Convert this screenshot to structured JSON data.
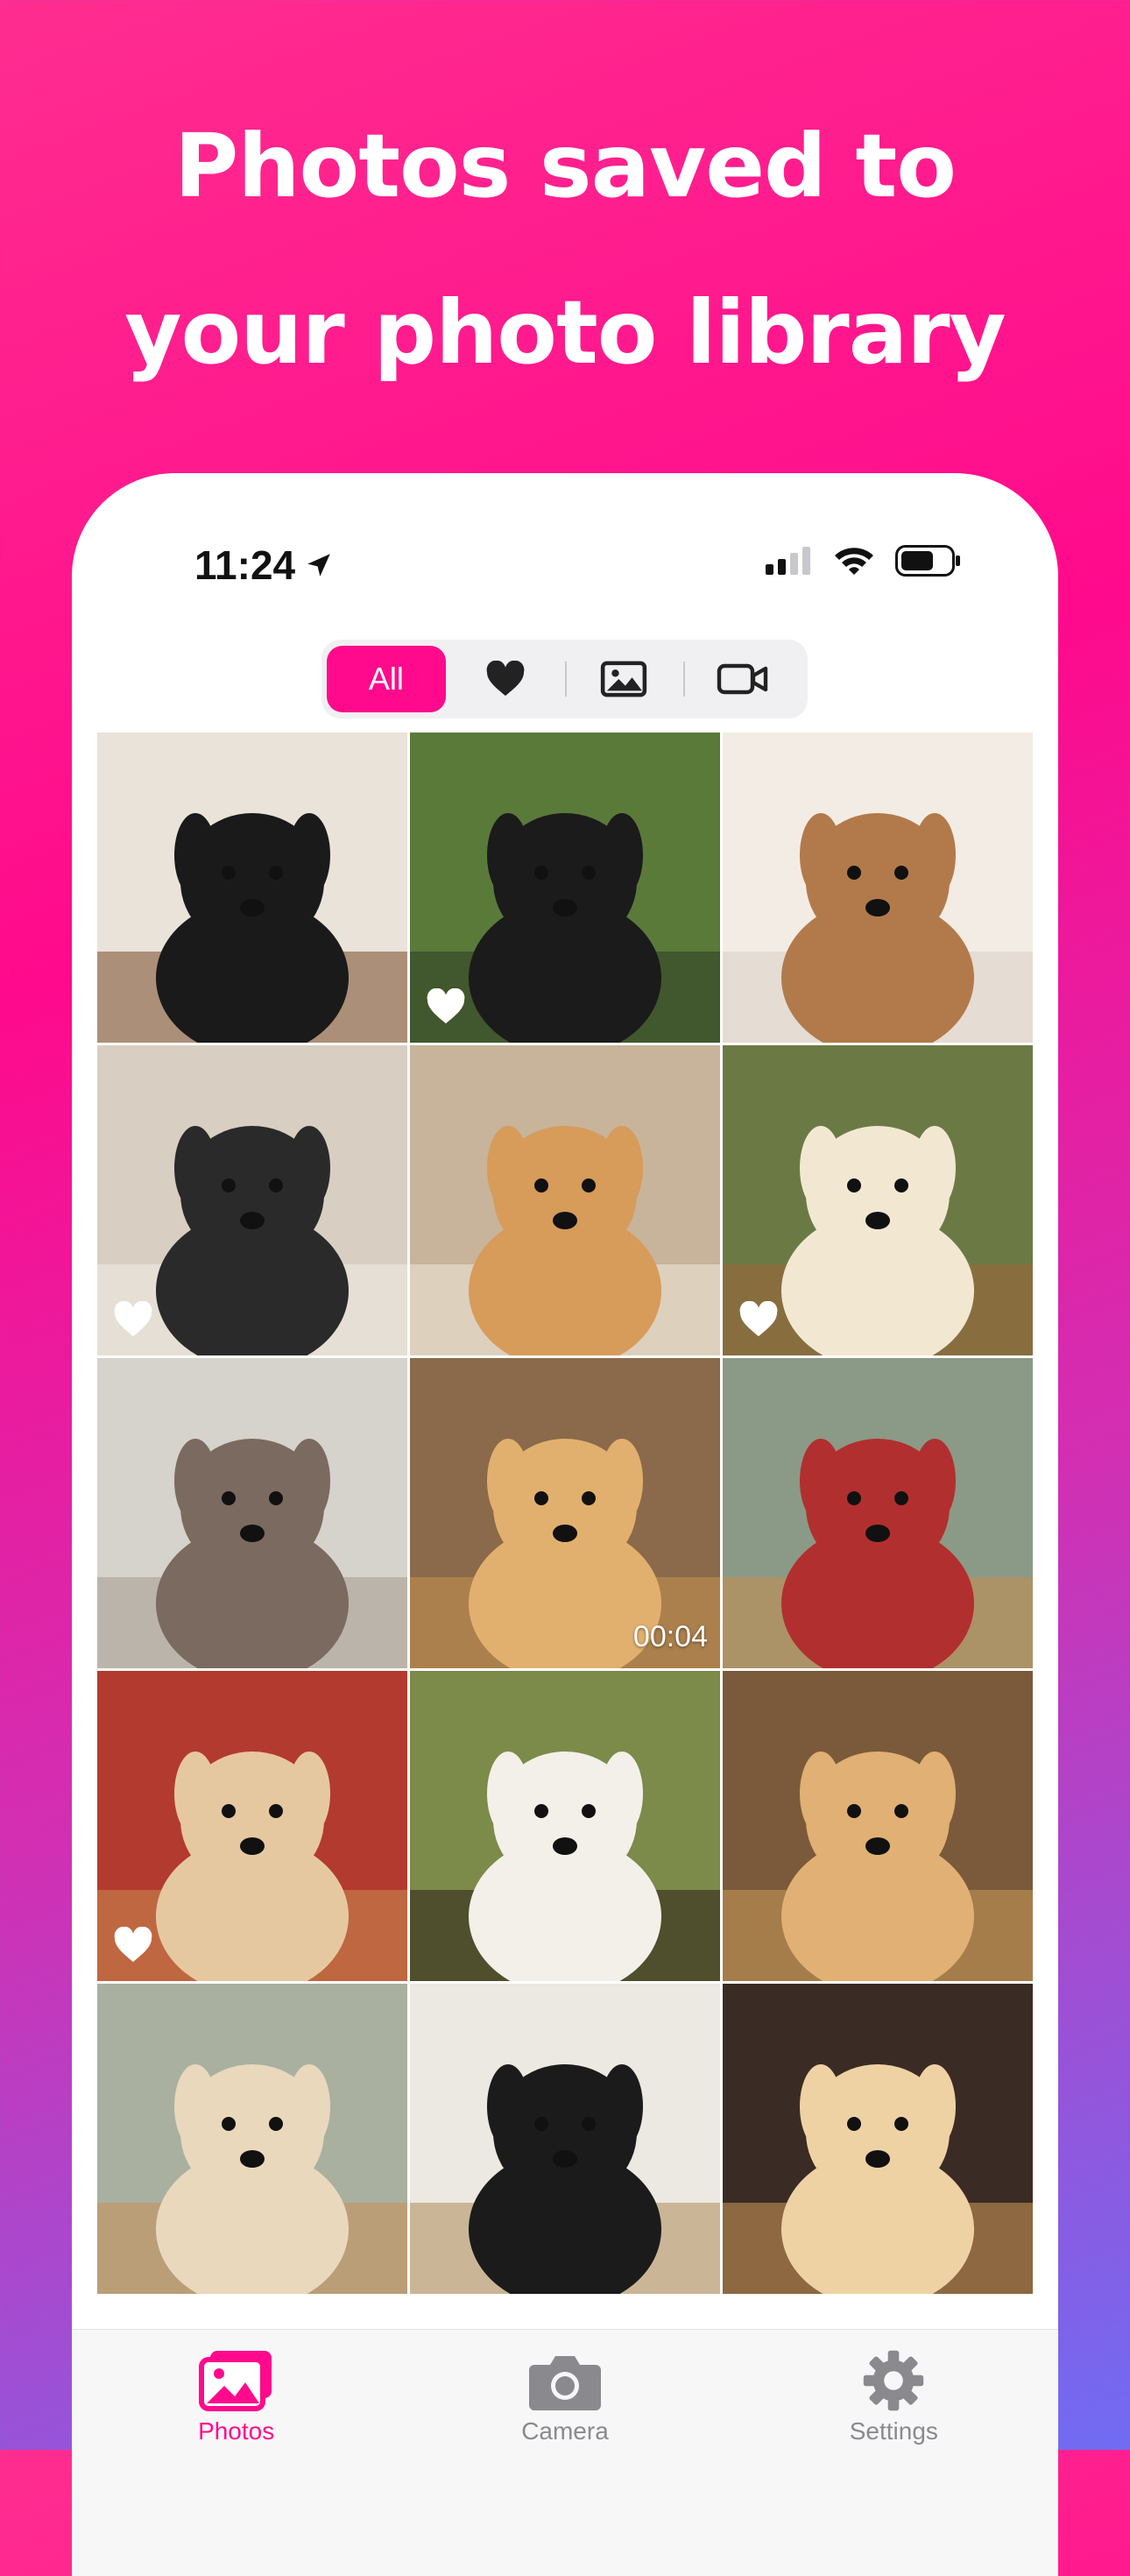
{
  "headline": {
    "line1": "Photos saved to",
    "line2": "your photo library"
  },
  "status_bar": {
    "time": "11:24"
  },
  "filter": {
    "active_label": "All",
    "icons": [
      "heart-icon",
      "photo-icon",
      "video-icon"
    ]
  },
  "colors": {
    "accent": "#ff0a8c",
    "background_top": "#ff2d8f",
    "background_bottom": "#6f6cf3"
  },
  "grid": {
    "items": [
      {
        "favorite": false,
        "duration": ""
      },
      {
        "favorite": true,
        "duration": ""
      },
      {
        "favorite": false,
        "duration": ""
      },
      {
        "favorite": true,
        "duration": ""
      },
      {
        "favorite": false,
        "duration": ""
      },
      {
        "favorite": true,
        "duration": ""
      },
      {
        "favorite": false,
        "duration": ""
      },
      {
        "favorite": false,
        "duration": "00:04"
      },
      {
        "favorite": false,
        "duration": ""
      },
      {
        "favorite": true,
        "duration": ""
      },
      {
        "favorite": false,
        "duration": ""
      },
      {
        "favorite": false,
        "duration": ""
      },
      {
        "favorite": false,
        "duration": ""
      },
      {
        "favorite": false,
        "duration": ""
      },
      {
        "favorite": false,
        "duration": ""
      }
    ]
  },
  "tabbar": {
    "items": [
      {
        "label": "Photos",
        "icon": "photos-icon",
        "active": true
      },
      {
        "label": "Camera",
        "icon": "camera-icon",
        "active": false
      },
      {
        "label": "Settings",
        "icon": "gear-icon",
        "active": false
      }
    ]
  }
}
